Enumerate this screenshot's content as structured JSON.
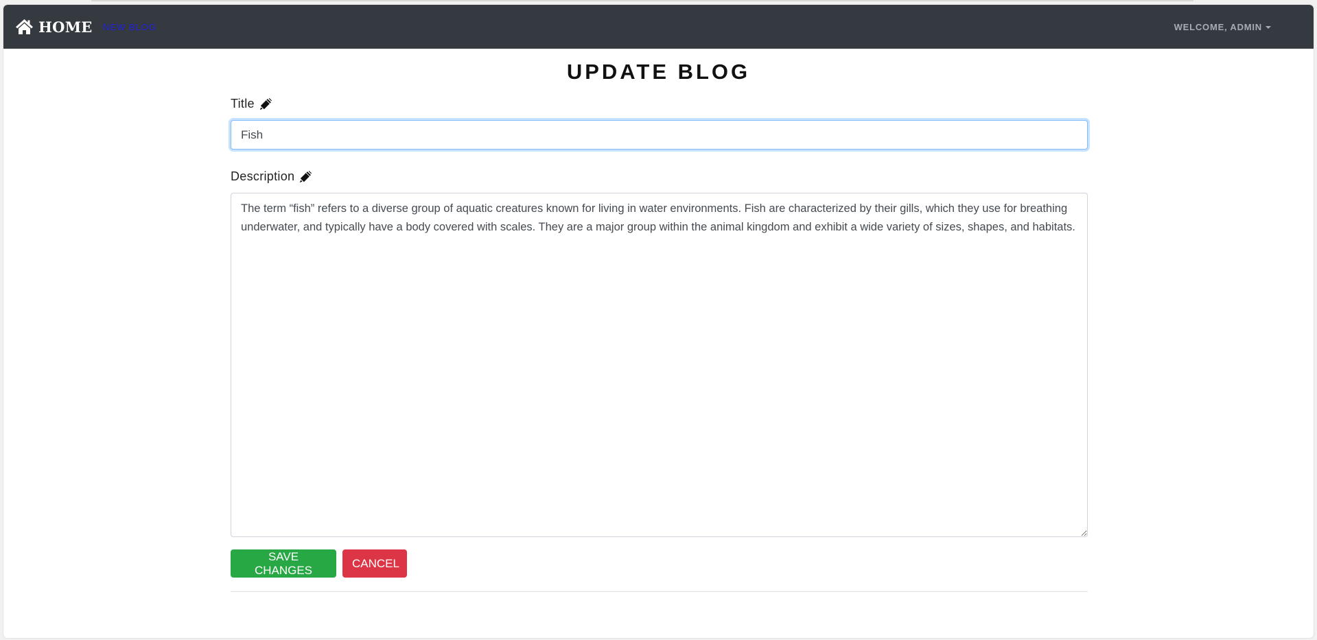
{
  "navbar": {
    "brand_label": "HOME",
    "new_blog_label": "NEW BLOG",
    "welcome_label": "WELCOME, ADMIN",
    "colors": {
      "background": "#343a40",
      "new_blog_link": "#1f1fe0",
      "welcome_text": "#a7adb3"
    },
    "icons": {
      "brand": "home-icon",
      "user_menu": "caret-down-icon"
    }
  },
  "page": {
    "title": "UPDATE BLOG"
  },
  "form": {
    "title_label": "Title",
    "title_value": "Fish",
    "description_label": "Description",
    "description_value": "The term “fish” refers to a diverse group of aquatic creatures known for living in water environments. Fish are characterized by their gills, which they use for breathing underwater, and typically have a body covered with scales. They are a major group within the animal kingdom and exhibit a wide variety of sizes, shapes, and habitats.",
    "label_icon": "pen-icon",
    "save_label": "SAVE CHANGES",
    "cancel_label": "CANCEL",
    "colors": {
      "save": "#28a745",
      "cancel": "#dc3545",
      "focus_border": "#80bdff"
    }
  }
}
